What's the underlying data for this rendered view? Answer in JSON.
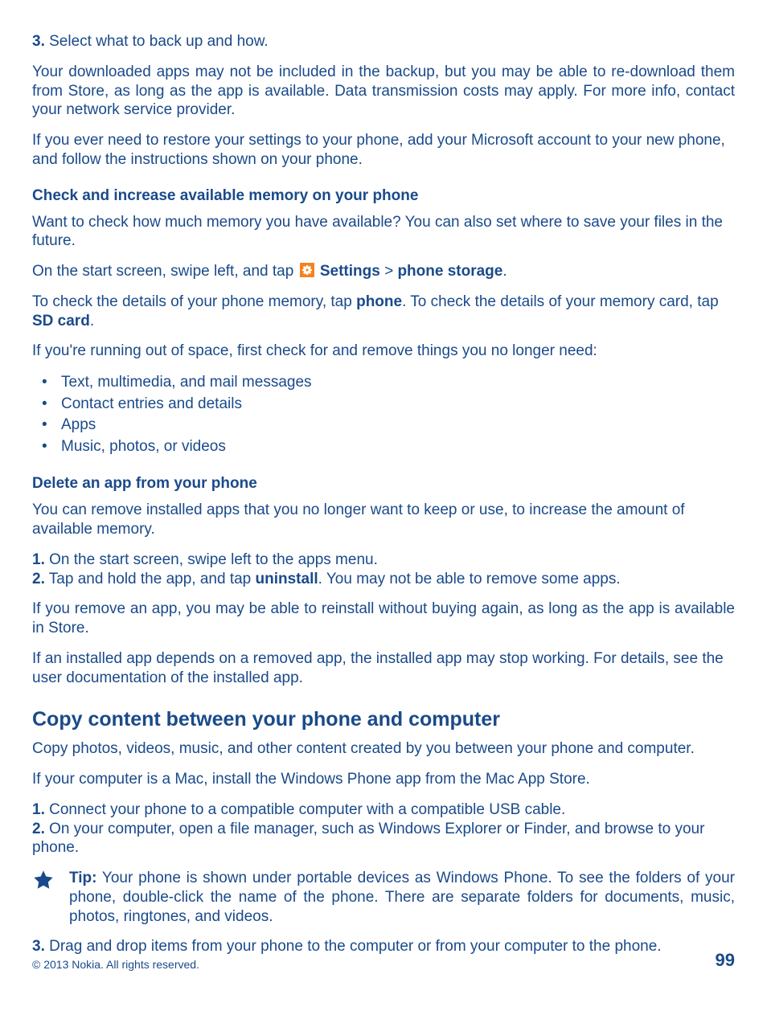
{
  "step3_pre": {
    "num": "3.",
    "text": " Select what to back up and how."
  },
  "para1": "Your downloaded apps may not be included in the backup, but you may be able to re-download them from Store, as long as the app is available. Data transmission costs may apply. For more info, contact your network service provider.",
  "para2": "If you ever need to restore your settings to your phone, add your Microsoft account to your new phone, and follow the instructions shown on your phone.",
  "heading_memory": "Check and increase available memory on your phone",
  "para_memory_intro": "Want to check how much memory you have available? You can also set where to save your files in the future.",
  "start_screen": {
    "pre": "On the start screen, swipe left, and tap ",
    "settings": " Settings",
    "sep": " > ",
    "phone_storage": "phone storage",
    "period": "."
  },
  "check_details": {
    "pre": "To check the details of your phone memory, tap ",
    "phone": "phone",
    "mid": ". To check the details of your memory card, tap ",
    "sd": "SD card",
    "period": "."
  },
  "running_out": "If you're running out of space, first check for and remove things you no longer need:",
  "bullets": [
    "Text, multimedia, and mail messages",
    "Contact entries and details",
    "Apps",
    "Music, photos, or videos"
  ],
  "heading_delete": "Delete an app from your phone",
  "delete_intro": "You can remove installed apps that you no longer want to keep or use, to increase the amount of available memory.",
  "delete_steps": {
    "s1": {
      "num": "1.",
      "text": " On the start screen, swipe left to the apps menu."
    },
    "s2": {
      "num": "2.",
      "pre": " Tap and hold the app, and tap ",
      "uninstall": "uninstall",
      "post": ". You may not be able to remove some apps."
    }
  },
  "delete_para1": "If you remove an app, you may be able to reinstall without buying again, as long as the app is available in Store.",
  "delete_para2": "If an installed app depends on a removed app, the installed app may stop working. For details, see the user documentation of the installed app.",
  "h2_copy": "Copy content between your phone and computer",
  "copy_intro": "Copy photos, videos, music, and other content created by you between your phone and computer.",
  "mac_note": "If your computer is a Mac, install the Windows Phone app from the Mac App Store.",
  "copy_steps": {
    "s1": {
      "num": "1.",
      "text": " Connect your phone to a compatible computer with a compatible USB cable."
    },
    "s2": {
      "num": "2.",
      "text": " On your computer, open a file manager, such as Windows Explorer or Finder, and browse to your phone."
    }
  },
  "tip": {
    "label": "Tip:",
    "text": " Your phone is shown under portable devices as Windows Phone. To see the folders of your phone, double-click the name of the phone. There are separate folders for documents, music, photos, ringtones, and videos."
  },
  "copy_step3": {
    "num": "3.",
    "text": " Drag and drop items from your phone to the computer or from your computer to the phone."
  },
  "footer": {
    "copyright": "© 2013 Nokia. All rights reserved.",
    "page": "99"
  }
}
